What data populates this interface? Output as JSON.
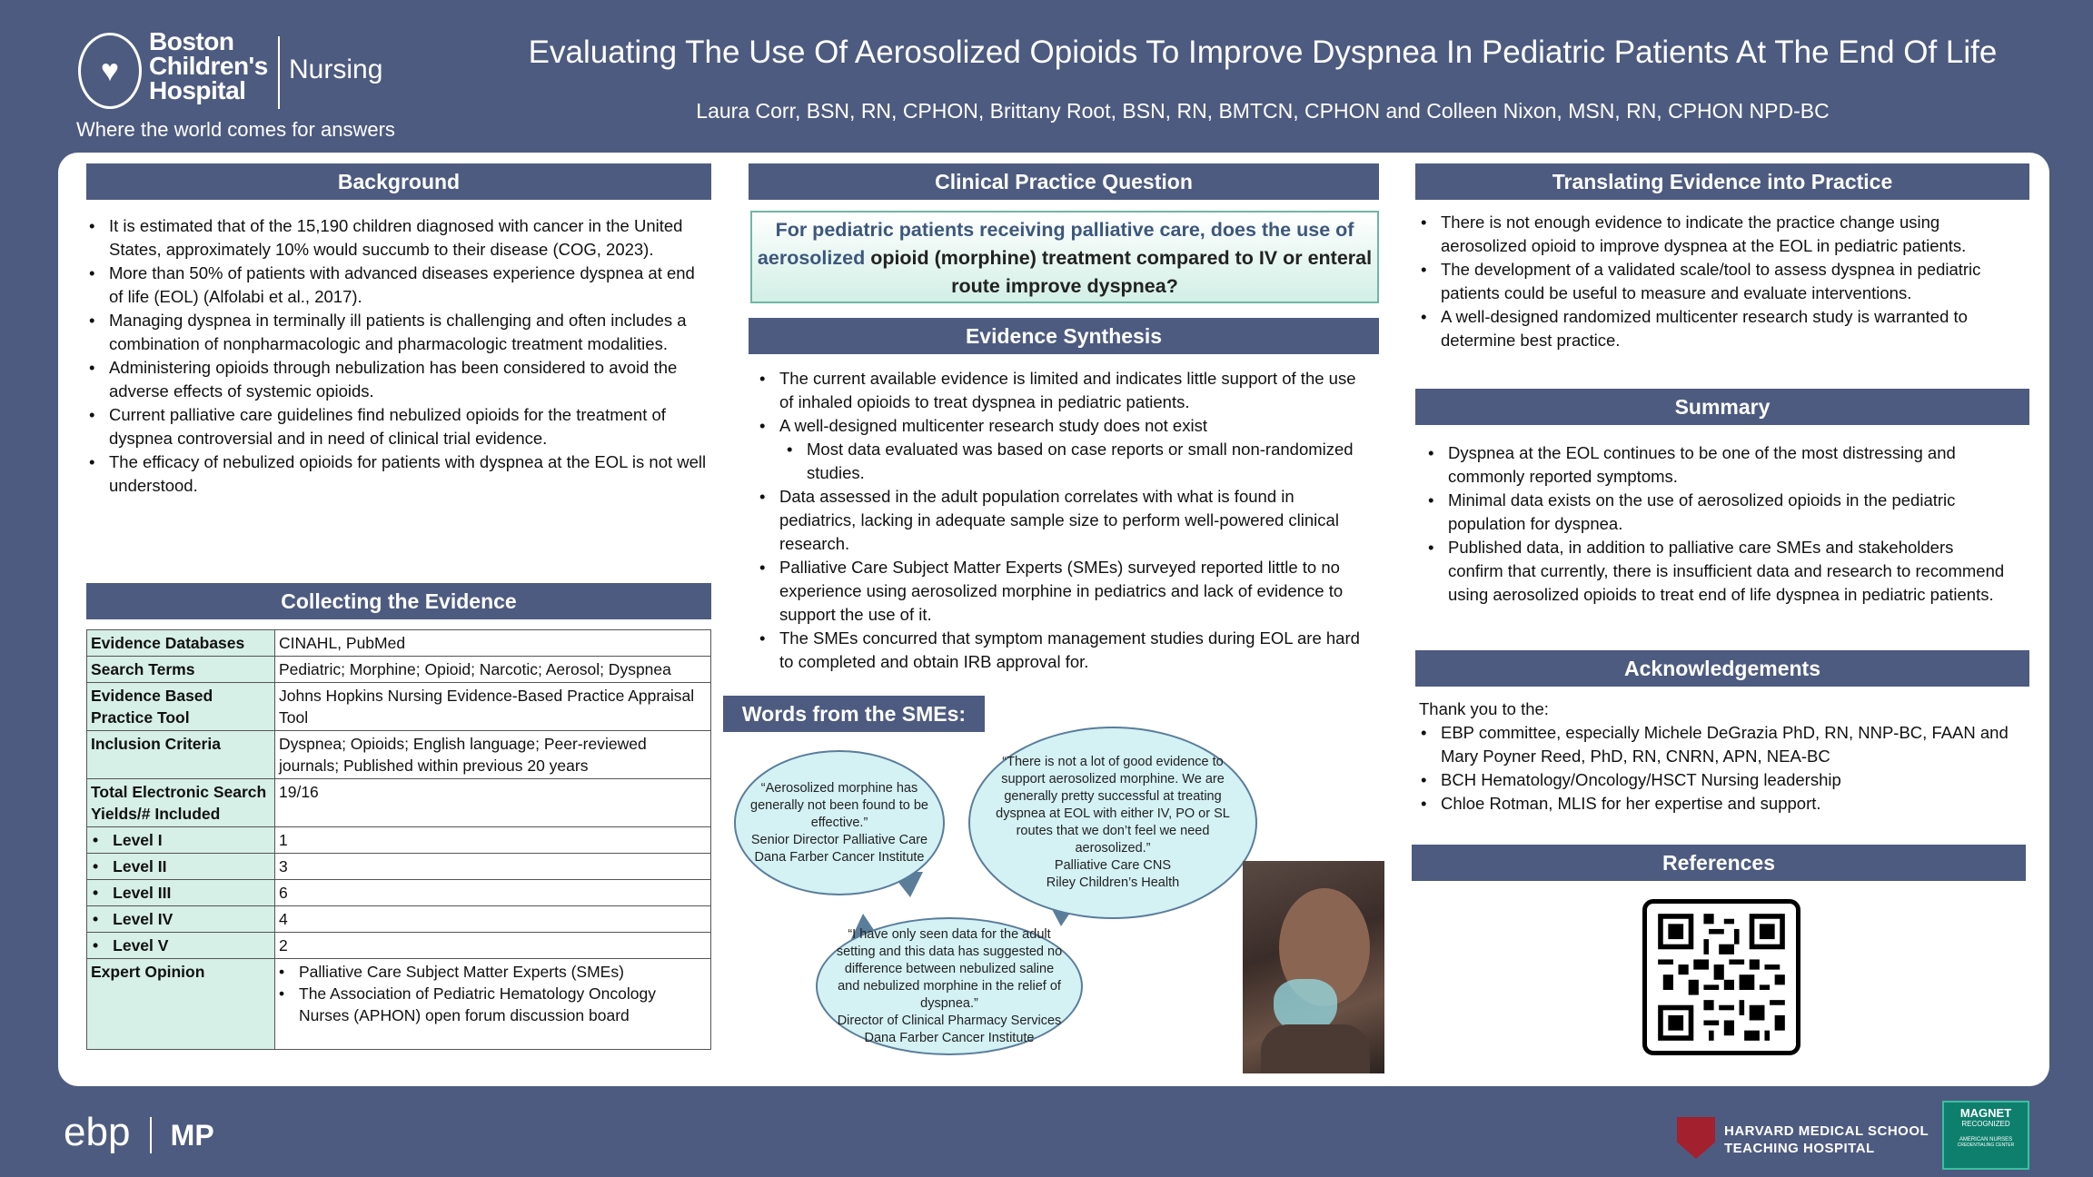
{
  "header": {
    "org_line1": "Boston",
    "org_line2": "Children's",
    "org_line3": "Hospital",
    "org_unit": "Nursing",
    "tagline": "Where the world comes for answers",
    "title": "Evaluating The Use Of Aerosolized Opioids To Improve Dyspnea In Pediatric Patients At The End Of Life",
    "authors": "Laura Corr, BSN, RN, CPHON, Brittany Root, BSN, RN, BMTCN, CPHON and Colleen Nixon, MSN, RN, CPHON NPD-BC"
  },
  "background": {
    "heading": "Background",
    "bullets": [
      "It is estimated that of the 15,190 children diagnosed with cancer in the United States, approximately 10% would succumb to their disease (COG, 2023).",
      "More than 50% of patients with advanced diseases experience dyspnea at end of life (EOL) (Alfolabi et al., 2017).",
      "Managing dyspnea in terminally ill patients is challenging and often includes a combination of nonpharmacologic and pharmacologic treatment modalities.",
      "Administering opioids through nebulization has been considered to avoid the adverse effects of systemic opioids.",
      "Current palliative care guidelines find nebulized opioids for the treatment of dyspnea controversial and in need of clinical trial evidence.",
      "The efficacy of nebulized opioids for patients with dyspnea at the EOL is not well understood."
    ]
  },
  "collecting": {
    "heading": "Collecting the Evidence",
    "rows": [
      {
        "k": "Evidence Databases",
        "v": "CINAHL, PubMed"
      },
      {
        "k": "Search Terms",
        "v": "Pediatric; Morphine; Opioid; Narcotic; Aerosol; Dyspnea"
      },
      {
        "k": "Evidence Based Practice Tool",
        "v": "Johns Hopkins Nursing Evidence-Based Practice Appraisal Tool"
      },
      {
        "k": "Inclusion Criteria",
        "v": "Dyspnea; Opioids; English language; Peer-reviewed journals; Published within previous 20 years"
      },
      {
        "k": "Total Electronic Search Yields/# Included",
        "v": "19/16"
      },
      {
        "k": "Level I",
        "v": "1"
      },
      {
        "k": "Level II",
        "v": "3"
      },
      {
        "k": "Level III",
        "v": "6"
      },
      {
        "k": "Level IV",
        "v": "4"
      },
      {
        "k": "Level V",
        "v": "2"
      }
    ],
    "expert_label": "Expert Opinion",
    "expert_items": [
      "Palliative Care Subject Matter Experts (SMEs)",
      "The Association of Pediatric Hematology Oncology Nurses (APHON) open forum discussion board"
    ]
  },
  "cpq": {
    "heading": "Clinical Practice Question",
    "part1": "For pediatric patients receiving palliative care, does the use of aerosolized",
    "part2": "opioid (morphine) treatment compared to IV or enteral route improve dyspnea?"
  },
  "synthesis": {
    "heading": "Evidence Synthesis",
    "b1": "The current available evidence is limited and indicates little support of the use of inhaled opioids to treat dyspnea in pediatric patients.",
    "b2": "A well-designed multicenter research study does not exist",
    "b2sub": "Most data evaluated was based on case reports or small non-randomized studies.",
    "b3": "Data assessed in the adult population correlates with what is found in pediatrics, lacking in adequate sample size to perform well-powered clinical research.",
    "b4": "Palliative Care Subject Matter Experts (SMEs) surveyed reported little to no experience using aerosolized morphine in pediatrics and lack of evidence to support the use of it.",
    "b5": "The SMEs concurred that symptom management studies during EOL are hard to completed and obtain IRB approval for."
  },
  "words": {
    "heading": "Words from the SMEs:",
    "q1": "“Aerosolized morphine has generally not been found to be effective.”",
    "q1_role": "Senior Director Palliative Care",
    "q1_org": "Dana Farber Cancer Institute",
    "q2": "“There is not a lot of good evidence to support aerosolized morphine. We are generally pretty successful at treating dyspnea at EOL with either IV, PO or SL routes that we don’t feel we need aerosolized.”",
    "q2_role": "Palliative Care CNS",
    "q2_org": "Riley Children’s Health",
    "q3": "“I have only seen data for the adult setting and this data has suggested no difference between nebulized saline and nebulized morphine in the relief of dyspnea.”",
    "q3_role": "Director of Clinical Pharmacy Services",
    "q3_org": "Dana Farber Cancer Institute"
  },
  "translating": {
    "heading": "Translating Evidence into Practice",
    "bullets": [
      "There is not enough evidence to indicate the practice change using aerosolized opioid to improve dyspnea at the EOL in pediatric patients.",
      "The development of a validated scale/tool to assess dyspnea in pediatric patients could be useful to measure and evaluate interventions.",
      "A well-designed randomized multicenter research study is warranted to determine best practice."
    ]
  },
  "summary": {
    "heading": "Summary",
    "bullets": [
      "Dyspnea at the EOL continues to be one of the most distressing and commonly reported symptoms.",
      "Minimal data exists on the use of aerosolized opioids in the pediatric population for dyspnea.",
      "Published data, in addition to palliative care SMEs and stakeholders confirm that currently, there is insufficient data and research to recommend using aerosolized opioids to treat end of life dyspnea in pediatric patients."
    ]
  },
  "ack": {
    "heading": "Acknowledgements",
    "intro": "Thank  you to the:",
    "bullets": [
      "EBP committee, especially Michele DeGrazia PhD, RN, NNP-BC, FAAN and Mary Poyner Reed, PhD, RN, CNRN, APN, NEA-BC",
      "BCH Hematology/Oncology/HSCT Nursing leadership",
      "Chloe Rotman, MLIS for her expertise and support."
    ]
  },
  "references": {
    "heading": "References"
  },
  "footer": {
    "ebp": "ebp",
    "mp": "MP",
    "hms_line1": "HARVARD MEDICAL SCHOOL",
    "hms_line2": "TEACHING HOSPITAL",
    "magnet_line1": "MAGNET",
    "magnet_line2": "RECOGNIZED",
    "magnet_line3": "AMERICAN NURSES",
    "magnet_line4": "CREDENTIALING CENTER"
  }
}
